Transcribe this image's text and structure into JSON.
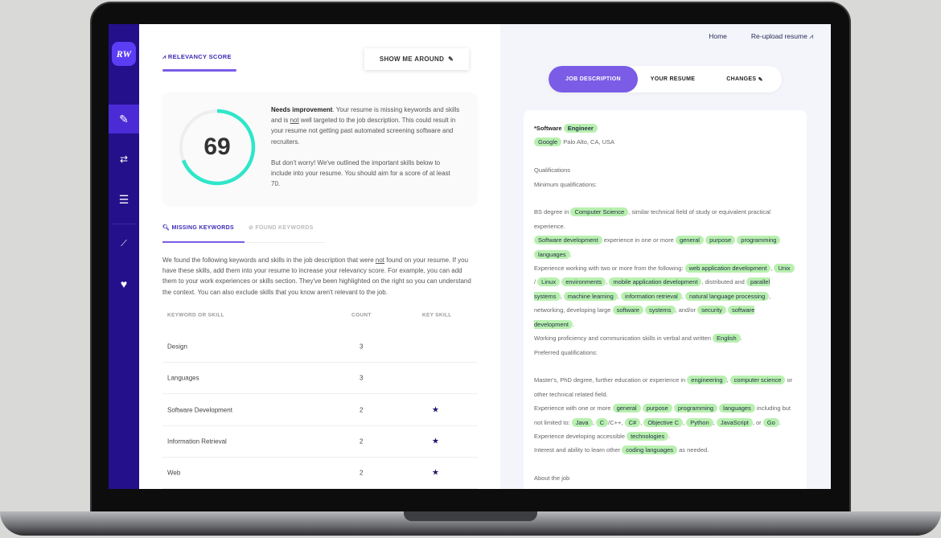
{
  "sidebar": {
    "logo": "RW",
    "items": [
      {
        "icon": "magic-wand-icon",
        "glyph": "✎",
        "active": true
      },
      {
        "icon": "handshake-icon",
        "glyph": "🤝"
      },
      {
        "icon": "list-icon",
        "glyph": "☰"
      },
      {
        "icon": "chart-icon",
        "glyph": "📈"
      },
      {
        "icon": "heart-icon",
        "glyph": "♥"
      }
    ]
  },
  "left": {
    "tab_relevancy": "RELEVANCY SCORE",
    "show_me_around": "SHOW ME AROUND",
    "score": 69,
    "score_color": "#2ee6c9",
    "status_bold": "Needs improvement",
    "status_text1": ". Your resume is missing keywords and skills and is ",
    "status_not": "not",
    "status_text2": " well targeted to the job description. This could result in your resume not getting past automated screening software and recruiters.",
    "status_para2": "But don't worry! We've outlined the important skills below to include into your resume. You should aim for a score of at least 70.",
    "tab_missing": "MISSING KEYWORDS",
    "tab_found": "FOUND KEYWORDS",
    "desc1": "We found the following keywords and skills in the job description that were ",
    "desc_not": "not",
    "desc2": " found on your resume. If you have these skills, add them into your resume to increase your relevancy score. For example, you can add them to your work experiences or skills section. They've been highlighted on the right so you can understand the context. You can also exclude skills that you know aren't relevant to the job.",
    "columns": [
      "KEYWORD OR SKILL",
      "COUNT",
      "KEY SKILL"
    ],
    "rows": [
      {
        "skill": "Design",
        "count": "3",
        "key": false
      },
      {
        "skill": "Languages",
        "count": "3",
        "key": false
      },
      {
        "skill": "Software Development",
        "count": "2",
        "key": true
      },
      {
        "skill": "Information Retrieval",
        "count": "2",
        "key": true
      },
      {
        "skill": "Web",
        "count": "2",
        "key": true
      }
    ]
  },
  "right": {
    "nav_home": "Home",
    "nav_reupload": "Re-upload resume",
    "tabs": [
      "JOB DESCRIPTION",
      "YOUR RESUME",
      "CHANGES"
    ],
    "active_tab": 0,
    "job": [
      [
        {
          "t": "*Software "
        },
        {
          "t": "Engineer",
          "h": 1
        }
      ],
      [
        {
          "t": "Google",
          "h": 1
        },
        {
          "t": " Palo Alto, CA, USA"
        }
      ],
      [],
      [
        {
          "t": "Qualifications"
        }
      ],
      [
        {
          "t": "Minimum qualifications:"
        }
      ],
      [],
      [
        {
          "t": "BS degree in "
        },
        {
          "t": "Computer  Science",
          "h": 1
        },
        {
          "t": ", similar technical field of study or equivalent practical experience."
        }
      ],
      [
        {
          "t": "Software  development",
          "h": 1
        },
        {
          "t": " experience in one or more "
        },
        {
          "t": "general",
          "h": 1
        },
        {
          "t": " "
        },
        {
          "t": "purpose",
          "h": 1
        },
        {
          "t": " "
        },
        {
          "t": "programming",
          "h": 1
        },
        {
          "t": " "
        },
        {
          "t": "languages",
          "h": 1
        },
        {
          "t": "."
        }
      ],
      [
        {
          "t": "Experience working with two or more from the following: "
        },
        {
          "t": "web  application  development",
          "h": 1
        },
        {
          "t": ", "
        },
        {
          "t": "Unix",
          "h": 1
        },
        {
          "t": " / "
        },
        {
          "t": "Linux",
          "h": 1
        },
        {
          "t": " "
        },
        {
          "t": "environments",
          "h": 1
        },
        {
          "t": ", "
        },
        {
          "t": "mobile  application  development",
          "h": 1
        },
        {
          "t": ", distributed and "
        },
        {
          "t": "parallel systems",
          "h": 1
        },
        {
          "t": ", "
        },
        {
          "t": "machine learning",
          "h": 1
        },
        {
          "t": ", "
        },
        {
          "t": "information retrieval",
          "h": 1
        },
        {
          "t": ", "
        },
        {
          "t": "natural language processing",
          "h": 1
        },
        {
          "t": ", networking, developing large "
        },
        {
          "t": "software",
          "h": 1
        },
        {
          "t": " "
        },
        {
          "t": "systems",
          "h": 1
        },
        {
          "t": ", and/or "
        },
        {
          "t": "security",
          "h": 1
        },
        {
          "t": " "
        },
        {
          "t": "software  development",
          "h": 1
        },
        {
          "t": "."
        }
      ],
      [
        {
          "t": "Working proficiency and communication skills in verbal and written "
        },
        {
          "t": "English",
          "h": 1
        },
        {
          "t": "."
        }
      ],
      [
        {
          "t": "Preferred qualifications:"
        }
      ],
      [],
      [
        {
          "t": "Master's, PhD degree, further education or experience in "
        },
        {
          "t": "engineering",
          "h": 1
        },
        {
          "t": ", "
        },
        {
          "t": "computer science",
          "h": 1
        },
        {
          "t": " or other technical related field."
        }
      ],
      [
        {
          "t": "Experience with one or more "
        },
        {
          "t": "general",
          "h": 1
        },
        {
          "t": " "
        },
        {
          "t": "purpose",
          "h": 1
        },
        {
          "t": " "
        },
        {
          "t": "programming",
          "h": 1
        },
        {
          "t": " "
        },
        {
          "t": "languages",
          "h": 1
        },
        {
          "t": " including but not limited to: "
        },
        {
          "t": "Java",
          "h": 1
        },
        {
          "t": ", "
        },
        {
          "t": "C",
          "h": 1
        },
        {
          "t": "/C++, "
        },
        {
          "t": "C#",
          "h": 1
        },
        {
          "t": ", "
        },
        {
          "t": "Objective C",
          "h": 1
        },
        {
          "t": ", "
        },
        {
          "t": "Python",
          "h": 1
        },
        {
          "t": ", "
        },
        {
          "t": "JavaScript",
          "h": 1
        },
        {
          "t": ", or "
        },
        {
          "t": "Go",
          "h": 1
        },
        {
          "t": "."
        }
      ],
      [
        {
          "t": "Experience developing accessible "
        },
        {
          "t": "technologies",
          "h": 1
        },
        {
          "t": "."
        }
      ],
      [
        {
          "t": "Interest and ability to learn other "
        },
        {
          "t": "coding  languages",
          "h": 1
        },
        {
          "t": " as needed."
        }
      ],
      [],
      [
        {
          "t": "About the job"
        }
      ]
    ]
  }
}
